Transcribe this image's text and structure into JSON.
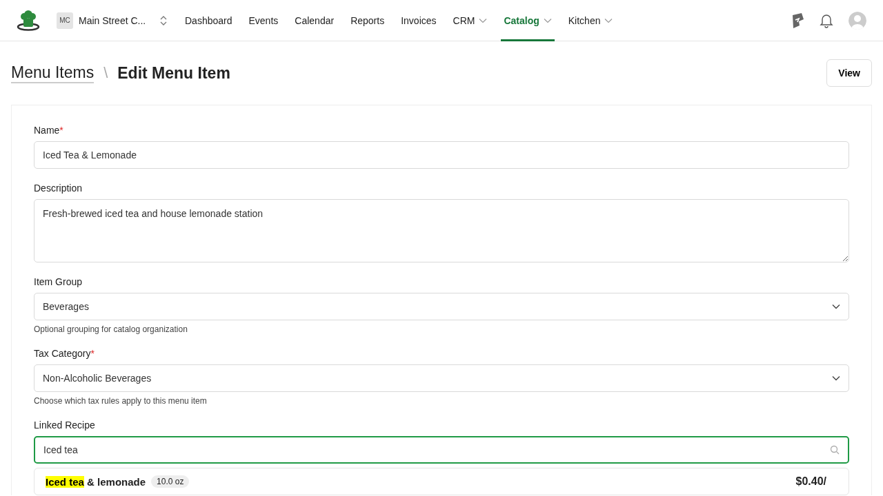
{
  "header": {
    "org_initials": "MC",
    "org_name": "Main Street C...",
    "nav": [
      {
        "label": "Dashboard",
        "selected": false,
        "dropdown": false
      },
      {
        "label": "Events",
        "selected": false,
        "dropdown": false
      },
      {
        "label": "Calendar",
        "selected": false,
        "dropdown": false
      },
      {
        "label": "Reports",
        "selected": false,
        "dropdown": false
      },
      {
        "label": "Invoices",
        "selected": false,
        "dropdown": false
      },
      {
        "label": "CRM",
        "selected": false,
        "dropdown": true
      },
      {
        "label": "Catalog",
        "selected": true,
        "dropdown": true
      },
      {
        "label": "Kitchen",
        "selected": false,
        "dropdown": true
      }
    ]
  },
  "breadcrumb": {
    "parent": "Menu Items",
    "separator": "\\",
    "current": "Edit Menu Item"
  },
  "view_button": "View",
  "fields": [
    {
      "kind": "text",
      "label": "Name",
      "required_mark": "*",
      "value": "Iced Tea & Lemonade"
    },
    {
      "kind": "textarea",
      "label": "Description",
      "value": "Fresh-brewed iced tea and house lemonade station"
    },
    {
      "kind": "select",
      "label": "Item Group",
      "value": "Beverages",
      "hint": "Optional grouping for catalog organization"
    },
    {
      "kind": "select",
      "label": "Tax Category",
      "required_mark": "*",
      "value": "Non-Alcoholic Beverages",
      "hint": "Choose which tax rules apply to this menu item"
    },
    {
      "kind": "search",
      "label": "Linked Recipe",
      "value": "Iced tea",
      "focused": true
    }
  ],
  "results": [
    {
      "match": "Iced tea",
      "rest": " & lemonade",
      "size": "10.0 oz",
      "price": "$0.40/"
    }
  ]
}
